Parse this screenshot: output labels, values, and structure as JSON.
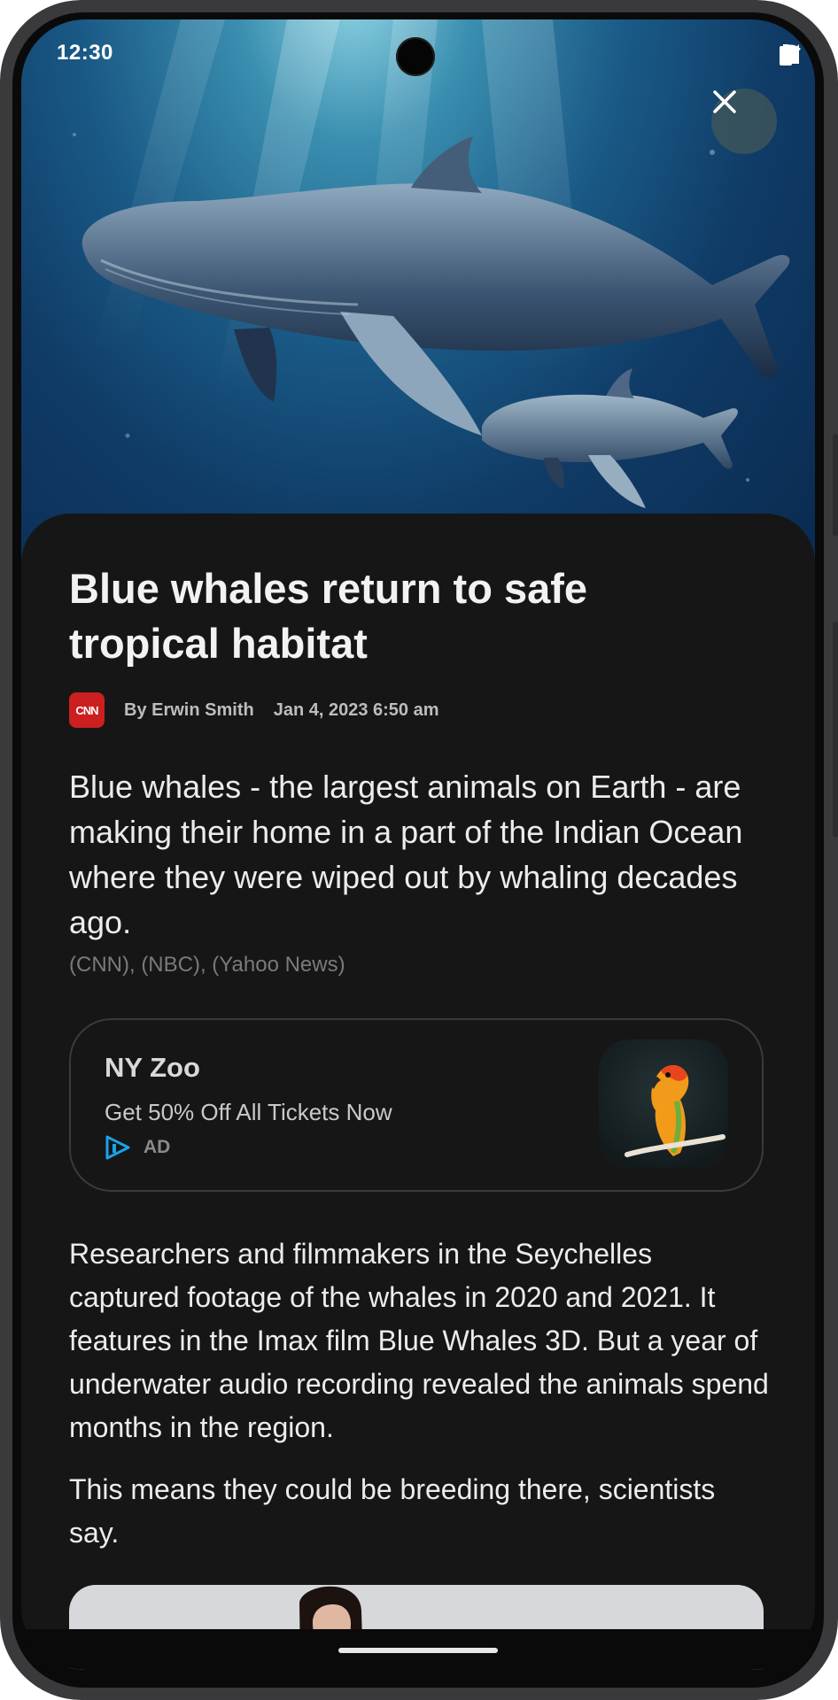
{
  "status_bar": {
    "time": "12:30",
    "icons": [
      "wifi-icon",
      "signal-icon",
      "battery-icon"
    ]
  },
  "hero": {
    "image_subject": "whale-image"
  },
  "controls": {
    "close_icon": "close-icon"
  },
  "article": {
    "title": "Blue whales return to safe tropical habitat",
    "publisher_logo": "CNN",
    "author": "By Erwin Smith",
    "date": "Jan 4, 2023 6:50 am",
    "lede": "Blue whales - the largest animals on Earth - are making their home in a part of the Indian Ocean where they were wiped out by whaling decades ago.",
    "sources": "(CNN), (NBC), (Yahoo News)",
    "paragraphs": [
      "Researchers and filmmakers in the Seychelles captured footage of the whales in 2020 and 2021. It features in the Imax film Blue Whales 3D. But a year of underwater audio recording revealed the animals spend months in the region.",
      "This means they could be breeding there, scientists say."
    ]
  },
  "ad": {
    "title": "NY Zoo",
    "subtitle": "Get 50% Off All Tickets Now",
    "label": "AD",
    "icon": "ad-play-icon",
    "image": "parrot-image"
  },
  "colors": {
    "background": "#161616",
    "cnn_red": "#cc1f1f",
    "ad_icon": "#1aa3e8"
  }
}
